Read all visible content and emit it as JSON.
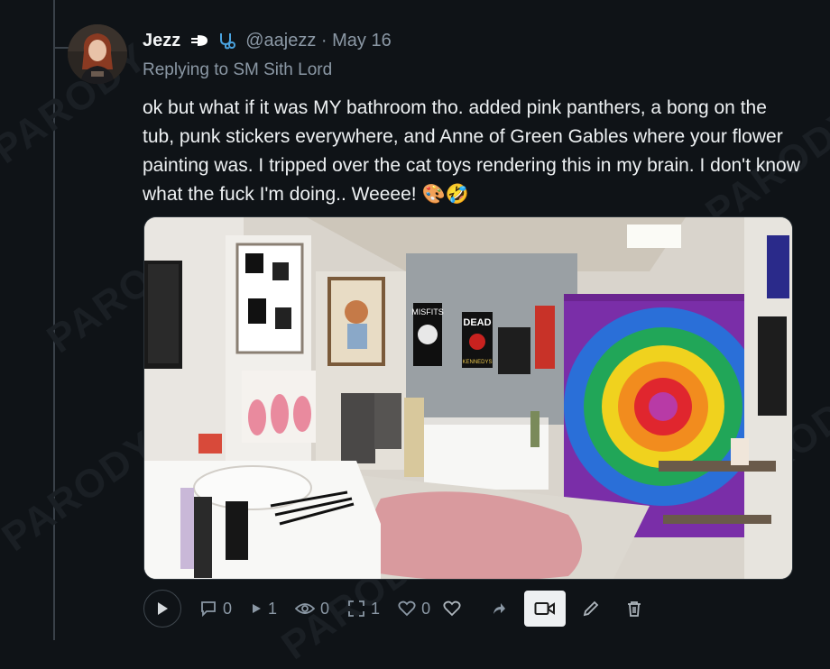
{
  "post": {
    "author_name": "Jezz",
    "handle_date": "@aajezz · May 16",
    "replying_to": "Replying to SM Sith Lord",
    "text": "ok but what if it was MY bathroom tho. added pink panthers, a bong on the tub, punk stickers everywhere, and Anne of Green Gables where your flower painting was. I tripped over the cat toys rendering this in my brain. I don't know what the fuck I'm doing.. Weeee! 🎨🤣"
  },
  "watermark": "PARODY",
  "media": {
    "poster_labels": [
      "DEAD",
      "KENNEDYS",
      "MISFITS"
    ]
  },
  "actions": {
    "replies": "0",
    "reposts": "1",
    "views": "0",
    "quotes": "1",
    "likes": "0"
  },
  "colors": {
    "background": "#0f1317",
    "text": "#e7e9ea",
    "muted": "#8b98a5",
    "thread_line": "#3a4149"
  },
  "icons": [
    "rocket-emoji-icon",
    "stethoscope-emoji-icon",
    "play-icon",
    "reply-icon",
    "repost-icon",
    "eye-icon",
    "quote-icon",
    "heart-icon",
    "share-icon",
    "video-icon",
    "edit-icon",
    "trash-icon"
  ]
}
